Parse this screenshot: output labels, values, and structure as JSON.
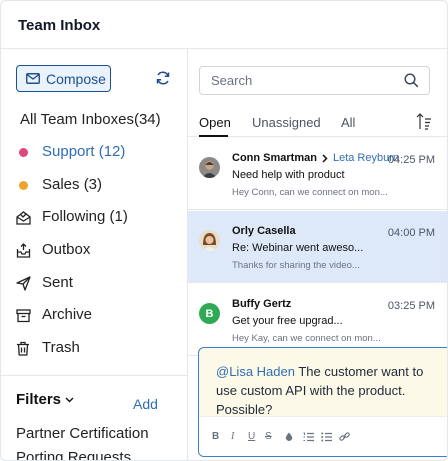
{
  "header": {
    "title": "Team Inbox"
  },
  "sidebar": {
    "compose_label": "Compose",
    "items": [
      {
        "label": "All Team Inboxes(34)"
      },
      {
        "label": "Support (12)",
        "dot_color": "#e0457b"
      },
      {
        "label": "Sales (3)",
        "dot_color": "#f0a32a"
      },
      {
        "label": "Following (1)"
      },
      {
        "label": "Outbox"
      },
      {
        "label": "Sent"
      },
      {
        "label": "Archive"
      },
      {
        "label": "Trash"
      }
    ],
    "filters_label": "Filters",
    "add_label": "Add",
    "filter_items": [
      "Partner Certification",
      "Porting Requests"
    ]
  },
  "main": {
    "search_placeholder": "Search",
    "tabs": [
      "Open",
      "Unassigned",
      "All"
    ],
    "conversations": [
      {
        "from": "Conn Smartman",
        "to": "Leta Reyburn",
        "time": "04:25 PM",
        "subject": "Need help with product",
        "preview": "Hey Conn, can we connect on mon..."
      },
      {
        "from": "Orly Casella",
        "time": "04:00 PM",
        "subject": "Re: Webinar went aweso...",
        "preview": "Thanks for sharing the video..."
      },
      {
        "from": "Buffy Gertz",
        "avatar_letter": "B",
        "time": "03:25 PM",
        "subject": "Get your free upgrad...",
        "preview": "Hey Kay, can we connect on mon..."
      }
    ],
    "note": {
      "mention": "@Lisa Haden",
      "text": " The customer want to use custom API with the product. Possible?"
    }
  },
  "colors": {
    "accent": "#2f6fb7",
    "compose_border": "#1e4f8f",
    "selected_row": "#dde9f9",
    "note_bg": "#fdf9e8",
    "avatar_green": "#2eaa55"
  }
}
